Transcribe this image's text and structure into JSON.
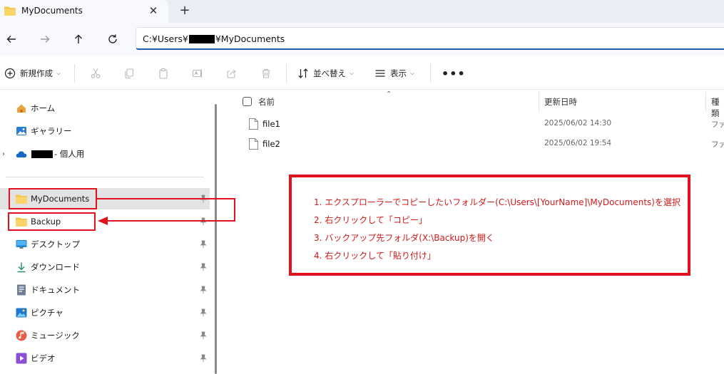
{
  "tab": {
    "title": "MyDocuments",
    "close_glyph": "✕",
    "new_tab_glyph": "+"
  },
  "address": {
    "prefix": "C:¥Users¥",
    "suffix": "¥MyDocuments"
  },
  "toolbar": {
    "new_label": "新規作成",
    "sort_label": "並べ替え",
    "view_label": "表示",
    "more_glyph": "•••"
  },
  "sidebar": {
    "home": "ホーム",
    "gallery": "ギャラリー",
    "onedrive_suffix": "- 個人用",
    "items": [
      {
        "label": "MyDocuments",
        "icon": "folder-icon"
      },
      {
        "label": "Backup",
        "icon": "folder-icon"
      },
      {
        "label": "デスクトップ",
        "icon": "desktop-icon"
      },
      {
        "label": "ダウンロード",
        "icon": "download-icon"
      },
      {
        "label": "ドキュメント",
        "icon": "document-icon"
      },
      {
        "label": "ピクチャ",
        "icon": "pictures-icon"
      },
      {
        "label": "ミュージック",
        "icon": "music-icon"
      },
      {
        "label": "ビデオ",
        "icon": "video-icon"
      }
    ]
  },
  "files": {
    "columns": {
      "name": "名前",
      "modified": "更新日時",
      "type": "種類"
    },
    "rows": [
      {
        "name": "file1",
        "modified": "2025/06/02 14:30",
        "type": "ファイル"
      },
      {
        "name": "file2",
        "modified": "2025/06/02 19:54",
        "type": "ファイル"
      }
    ]
  },
  "annotation": {
    "lines": [
      "1. エクスプローラーでコピーしたいフォルダー(C:\\Users\\[YourName]\\MyDocuments)を選択",
      "2. 右クリックして「コピー」",
      "3. バックアップ先フォルダ(X:\\Backup)を開く",
      "4. 右クリックして「貼り付け」"
    ],
    "color": "#e3101e"
  }
}
